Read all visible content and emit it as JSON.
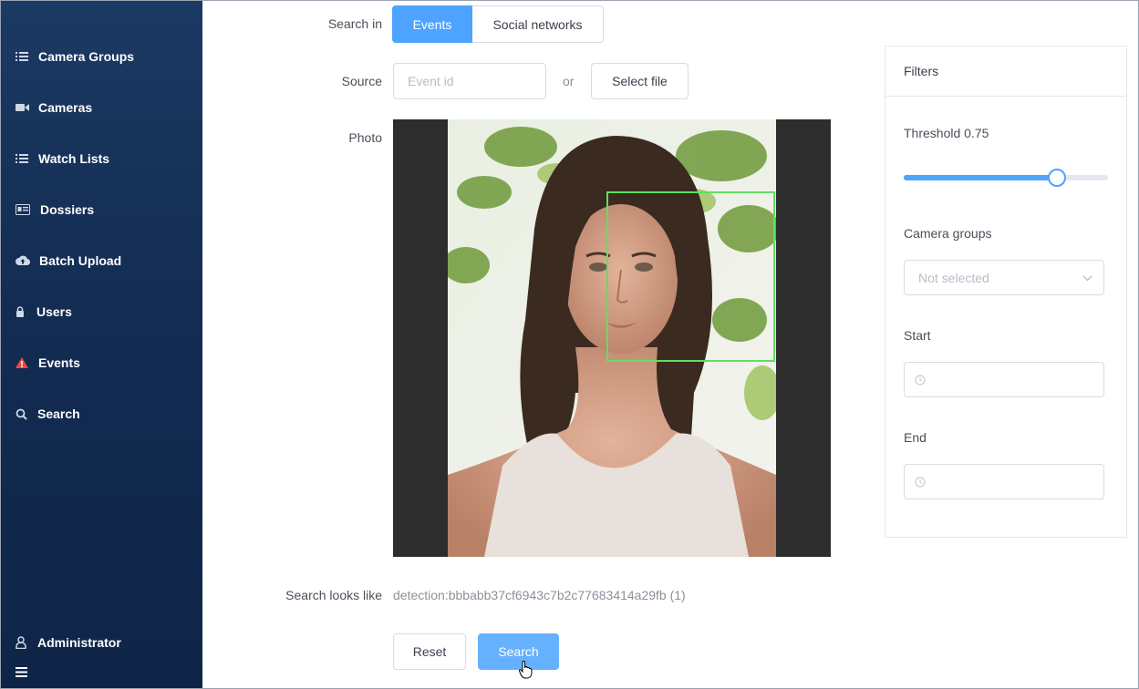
{
  "sidebar": {
    "items": [
      {
        "label": "Camera Groups",
        "icon": "list-icon"
      },
      {
        "label": "Cameras",
        "icon": "video-camera-icon"
      },
      {
        "label": "Watch Lists",
        "icon": "list-icon"
      },
      {
        "label": "Dossiers",
        "icon": "id-card-icon"
      },
      {
        "label": "Batch Upload",
        "icon": "cloud-upload-icon"
      },
      {
        "label": "Users",
        "icon": "lock-icon"
      },
      {
        "label": "Events",
        "icon": "warning-icon"
      },
      {
        "label": "Search",
        "icon": "search-icon"
      }
    ],
    "user": {
      "label": "Administrator",
      "icon": "user-icon"
    },
    "menu_icon": "hamburger-icon",
    "events_icon_color": "#f0493e"
  },
  "form": {
    "search_in_label": "Search in",
    "tabs": [
      {
        "label": "Events",
        "active": true
      },
      {
        "label": "Social networks",
        "active": false
      }
    ],
    "source_label": "Source",
    "event_id_placeholder": "Event id",
    "or_text": "or",
    "select_file_label": "Select file",
    "photo_label": "Photo",
    "search_looks_like_label": "Search looks like",
    "search_looks_like_value": "detection:bbbabb37cf6943c7b2c77683414a29fb (1)",
    "reset_label": "Reset",
    "search_label": "Search"
  },
  "filters": {
    "title": "Filters",
    "threshold_label": "Threshold 0.75",
    "threshold_value": 0.75,
    "camera_groups_label": "Camera groups",
    "camera_groups_value": "Not selected",
    "start_label": "Start",
    "end_label": "End"
  },
  "colors": {
    "accent": "#4da3ff",
    "primary_button": "#66b1ff",
    "sidebar_bg": "#132c52",
    "face_box": "#5fe05f"
  }
}
